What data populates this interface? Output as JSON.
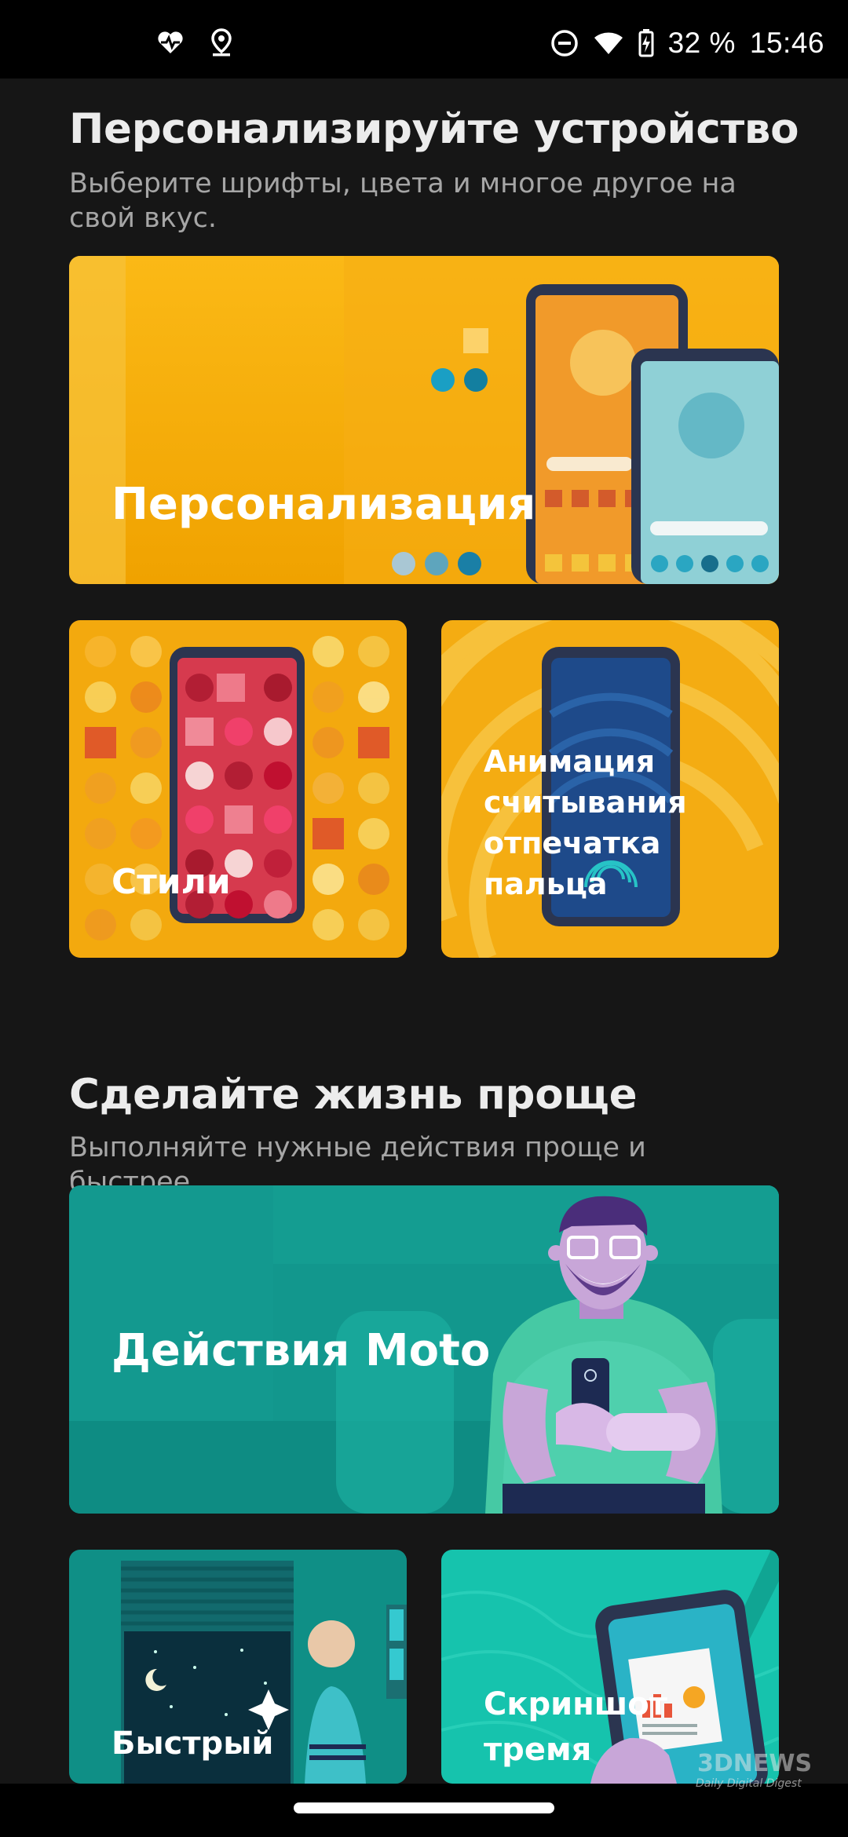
{
  "status_bar": {
    "battery": "32 %",
    "time": "15:46",
    "icons": [
      "heart-pulse-icon",
      "location-pin-icon",
      "do-not-disturb-icon",
      "wifi-icon",
      "battery-charging-icon"
    ]
  },
  "personalize": {
    "title": "Персонализируйте устройство",
    "subtitle": "Выберите шрифты, цвета и многое другое на свой вкус.",
    "cards": {
      "personalization": "Персонализация",
      "styles": "Стили",
      "fingerprint": "Анимация считывания отпечатка пальца"
    }
  },
  "simplify": {
    "title": "Сделайте жизнь проще",
    "subtitle": "Выполняйте нужные действия проще и быстрее.",
    "cards": {
      "moto_actions": "Действия Moto",
      "quick": "Быстрый",
      "screenshot": "Скриншот тремя"
    }
  },
  "watermark": {
    "brand": "3DNEWS",
    "tagline": "Daily Digital Digest"
  },
  "colors": {
    "background": "#161616",
    "amber": "#f5b400",
    "teal": "#0f9a90"
  }
}
